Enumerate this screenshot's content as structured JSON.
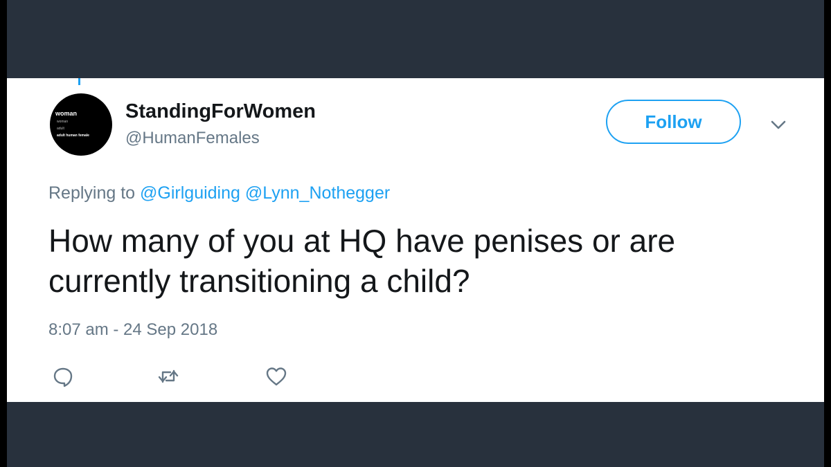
{
  "tweet": {
    "display_name": "StandingForWomen",
    "handle": "@HumanFemales",
    "avatar": {
      "title": "woman",
      "lines": [
        "woman",
        "adult",
        "adult human female"
      ]
    },
    "follow_label": "Follow",
    "replying_prefix": "Replying to",
    "mentions": [
      "@Girlguiding",
      "@Lynn_Nothegger"
    ],
    "text": "How many of you at HQ have penises or are currently transitioning a child?",
    "timestamp": "8:07 am - 24 Sep 2018",
    "actions": [
      {
        "name": "reply",
        "icon": "speech-bubble-icon"
      },
      {
        "name": "retweet",
        "icon": "retweet-arrows-icon"
      },
      {
        "name": "like",
        "icon": "heart-icon"
      }
    ],
    "more_menu_icon": "chevron-down-icon"
  },
  "colors": {
    "background": "#28313d",
    "card": "#ffffff",
    "accent": "#1da1f2",
    "text": "#14171a",
    "muted": "#657786"
  }
}
